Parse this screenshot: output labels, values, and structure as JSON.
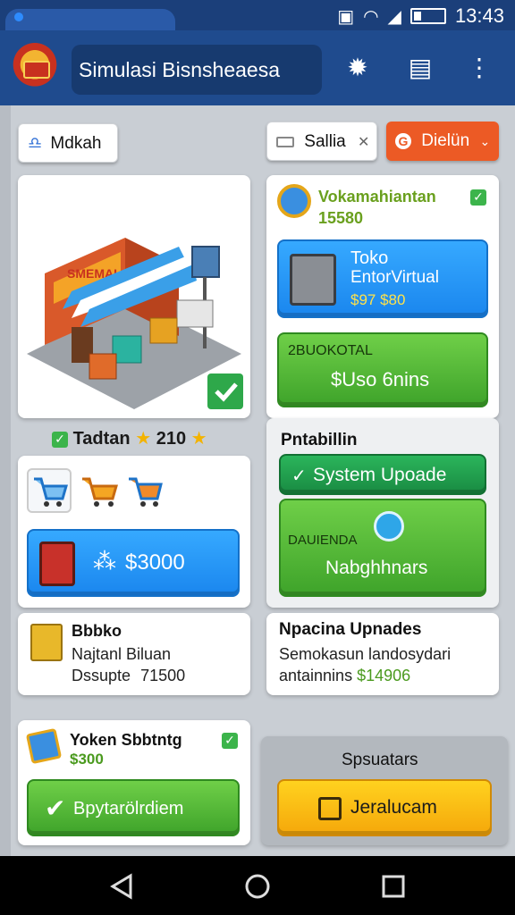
{
  "status_bar": {
    "time": "13:43"
  },
  "app": {
    "title": "Simulasi Bisnsheaesa"
  },
  "filters": {
    "left_chip": "Mdkah",
    "search_chip": "Sallia",
    "dropdown": "Dielün"
  },
  "store_card": {
    "rating_text": "Tadtan",
    "rating_value": "210"
  },
  "cart_card": {
    "buy_price": "$3000"
  },
  "stock_card": {
    "title": "Bbbko",
    "line1": "Najtanl Biluan",
    "line2": "Dssupte",
    "price": "71500"
  },
  "token_card": {
    "title": "Yoken Sbbtntg",
    "price": "$300",
    "button": "Bpytarölrdiem"
  },
  "reward_card": {
    "title": "Vokamahiantan",
    "amount": "15580"
  },
  "toko_button": {
    "title": "Toko",
    "subtitle": "EntorVirtual",
    "price": "$97 $80"
  },
  "promo_button": {
    "top": "2BUOKOTAL",
    "main": "$Uso 6nins"
  },
  "potential": {
    "title": "Pntabillin",
    "system_button": "System Upoade",
    "inner_label": "DAUIENDA",
    "nav_button": "Nabghhnars"
  },
  "upgrades_card": {
    "title": "Npacina Upnades",
    "line1": "Semokasun landosydari",
    "line2": "antainnins",
    "amount": "$14906"
  },
  "sponsor": {
    "title": "Spsuatars",
    "button": "Jeralucam"
  },
  "colors": {
    "appbar": "#1f4b8e",
    "accent_orange": "#ec5a25",
    "accent_blue": "#1a86ee",
    "accent_green": "#3ea32a",
    "accent_yellow": "#f5a70a"
  }
}
